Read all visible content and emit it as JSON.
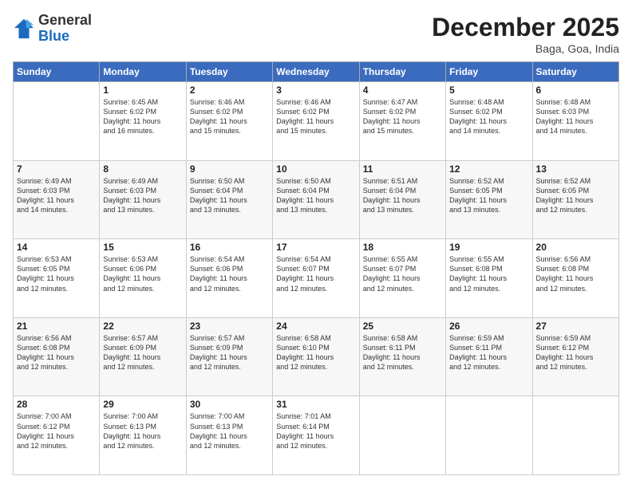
{
  "header": {
    "logo_general": "General",
    "logo_blue": "Blue",
    "month_title": "December 2025",
    "location": "Baga, Goa, India"
  },
  "weekdays": [
    "Sunday",
    "Monday",
    "Tuesday",
    "Wednesday",
    "Thursday",
    "Friday",
    "Saturday"
  ],
  "weeks": [
    [
      {
        "day": "",
        "info": ""
      },
      {
        "day": "1",
        "info": "Sunrise: 6:45 AM\nSunset: 6:02 PM\nDaylight: 11 hours\nand 16 minutes."
      },
      {
        "day": "2",
        "info": "Sunrise: 6:46 AM\nSunset: 6:02 PM\nDaylight: 11 hours\nand 15 minutes."
      },
      {
        "day": "3",
        "info": "Sunrise: 6:46 AM\nSunset: 6:02 PM\nDaylight: 11 hours\nand 15 minutes."
      },
      {
        "day": "4",
        "info": "Sunrise: 6:47 AM\nSunset: 6:02 PM\nDaylight: 11 hours\nand 15 minutes."
      },
      {
        "day": "5",
        "info": "Sunrise: 6:48 AM\nSunset: 6:02 PM\nDaylight: 11 hours\nand 14 minutes."
      },
      {
        "day": "6",
        "info": "Sunrise: 6:48 AM\nSunset: 6:03 PM\nDaylight: 11 hours\nand 14 minutes."
      }
    ],
    [
      {
        "day": "7",
        "info": "Sunrise: 6:49 AM\nSunset: 6:03 PM\nDaylight: 11 hours\nand 14 minutes."
      },
      {
        "day": "8",
        "info": "Sunrise: 6:49 AM\nSunset: 6:03 PM\nDaylight: 11 hours\nand 13 minutes."
      },
      {
        "day": "9",
        "info": "Sunrise: 6:50 AM\nSunset: 6:04 PM\nDaylight: 11 hours\nand 13 minutes."
      },
      {
        "day": "10",
        "info": "Sunrise: 6:50 AM\nSunset: 6:04 PM\nDaylight: 11 hours\nand 13 minutes."
      },
      {
        "day": "11",
        "info": "Sunrise: 6:51 AM\nSunset: 6:04 PM\nDaylight: 11 hours\nand 13 minutes."
      },
      {
        "day": "12",
        "info": "Sunrise: 6:52 AM\nSunset: 6:05 PM\nDaylight: 11 hours\nand 13 minutes."
      },
      {
        "day": "13",
        "info": "Sunrise: 6:52 AM\nSunset: 6:05 PM\nDaylight: 11 hours\nand 12 minutes."
      }
    ],
    [
      {
        "day": "14",
        "info": "Sunrise: 6:53 AM\nSunset: 6:05 PM\nDaylight: 11 hours\nand 12 minutes."
      },
      {
        "day": "15",
        "info": "Sunrise: 6:53 AM\nSunset: 6:06 PM\nDaylight: 11 hours\nand 12 minutes."
      },
      {
        "day": "16",
        "info": "Sunrise: 6:54 AM\nSunset: 6:06 PM\nDaylight: 11 hours\nand 12 minutes."
      },
      {
        "day": "17",
        "info": "Sunrise: 6:54 AM\nSunset: 6:07 PM\nDaylight: 11 hours\nand 12 minutes."
      },
      {
        "day": "18",
        "info": "Sunrise: 6:55 AM\nSunset: 6:07 PM\nDaylight: 11 hours\nand 12 minutes."
      },
      {
        "day": "19",
        "info": "Sunrise: 6:55 AM\nSunset: 6:08 PM\nDaylight: 11 hours\nand 12 minutes."
      },
      {
        "day": "20",
        "info": "Sunrise: 6:56 AM\nSunset: 6:08 PM\nDaylight: 11 hours\nand 12 minutes."
      }
    ],
    [
      {
        "day": "21",
        "info": "Sunrise: 6:56 AM\nSunset: 6:08 PM\nDaylight: 11 hours\nand 12 minutes."
      },
      {
        "day": "22",
        "info": "Sunrise: 6:57 AM\nSunset: 6:09 PM\nDaylight: 11 hours\nand 12 minutes."
      },
      {
        "day": "23",
        "info": "Sunrise: 6:57 AM\nSunset: 6:09 PM\nDaylight: 11 hours\nand 12 minutes."
      },
      {
        "day": "24",
        "info": "Sunrise: 6:58 AM\nSunset: 6:10 PM\nDaylight: 11 hours\nand 12 minutes."
      },
      {
        "day": "25",
        "info": "Sunrise: 6:58 AM\nSunset: 6:11 PM\nDaylight: 11 hours\nand 12 minutes."
      },
      {
        "day": "26",
        "info": "Sunrise: 6:59 AM\nSunset: 6:11 PM\nDaylight: 11 hours\nand 12 minutes."
      },
      {
        "day": "27",
        "info": "Sunrise: 6:59 AM\nSunset: 6:12 PM\nDaylight: 11 hours\nand 12 minutes."
      }
    ],
    [
      {
        "day": "28",
        "info": "Sunrise: 7:00 AM\nSunset: 6:12 PM\nDaylight: 11 hours\nand 12 minutes."
      },
      {
        "day": "29",
        "info": "Sunrise: 7:00 AM\nSunset: 6:13 PM\nDaylight: 11 hours\nand 12 minutes."
      },
      {
        "day": "30",
        "info": "Sunrise: 7:00 AM\nSunset: 6:13 PM\nDaylight: 11 hours\nand 12 minutes."
      },
      {
        "day": "31",
        "info": "Sunrise: 7:01 AM\nSunset: 6:14 PM\nDaylight: 11 hours\nand 12 minutes."
      },
      {
        "day": "",
        "info": ""
      },
      {
        "day": "",
        "info": ""
      },
      {
        "day": "",
        "info": ""
      }
    ]
  ]
}
